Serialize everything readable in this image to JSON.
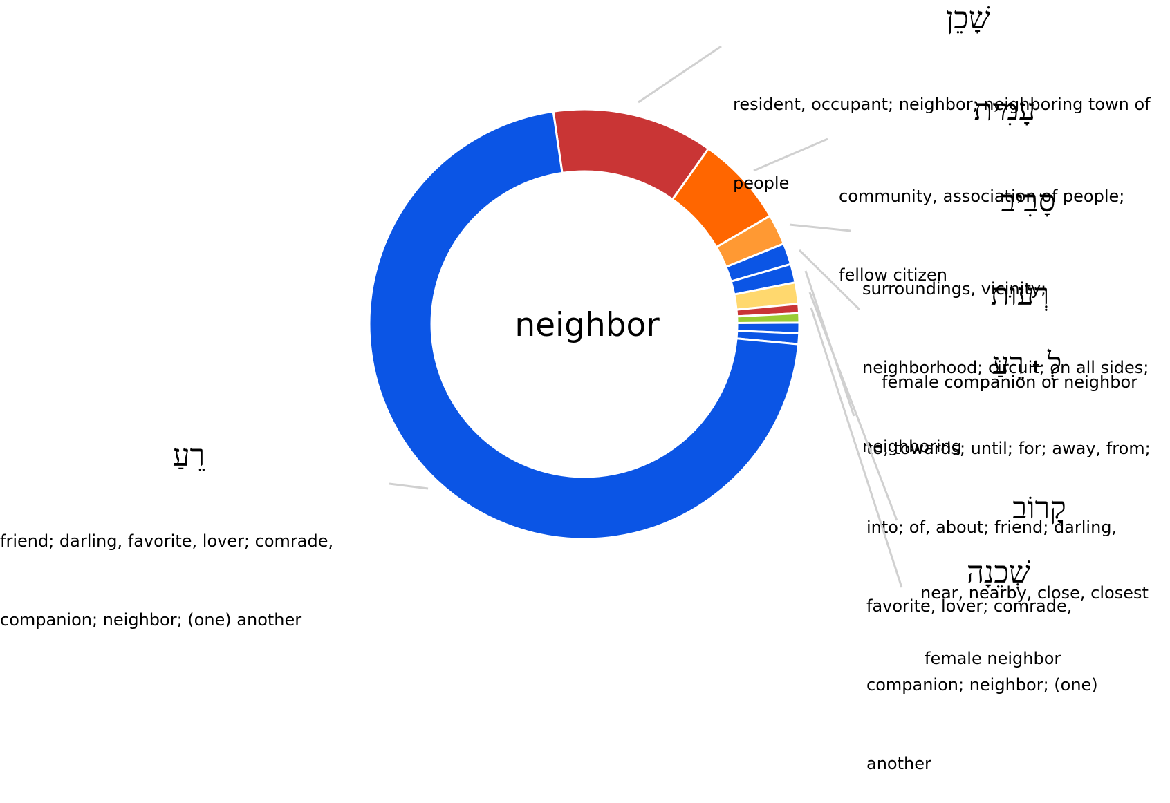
{
  "chart_data": {
    "type": "pie",
    "variant": "donut",
    "title": "neighbor",
    "start_angle_deg": -8.3,
    "direction": "clockwise",
    "slices": [
      {
        "id": "shakhen",
        "hebrew": "שָׁכֵן",
        "gloss": [
          "resident, occupant; neighbor; neighboring town of",
          "people"
        ],
        "value": 12.1,
        "color": "#c93535",
        "labeled": true
      },
      {
        "id": "amit",
        "hebrew": "עָמִית",
        "gloss": [
          "community, association of people;",
          "fellow citizen"
        ],
        "value": 6.8,
        "color": "#ff6600",
        "labeled": true
      },
      {
        "id": "saviv",
        "hebrew": "סָבִיב",
        "gloss": [
          "surroundings, vicinity;",
          "neighborhood; circuit; on all sides;",
          "neighboring"
        ],
        "value": 2.3,
        "color": "#ff9933",
        "labeled": true
      },
      {
        "id": "reut",
        "hebrew": "רְעוּת",
        "gloss": [
          "female companion or neighbor"
        ],
        "value": 1.6,
        "color": "#0b55e5",
        "labeled": true
      },
      {
        "id": "le-rea",
        "hebrew_parts": [
          "לְ",
          "+",
          "רֵעַ"
        ],
        "gloss": [
          "to, towards; until; for; away, from;",
          "into; of, about; friend; darling,",
          "favorite, lover; comrade,",
          "companion; neighbor; (one)",
          "another"
        ],
        "value": 1.4,
        "color": "#0b55e5",
        "labeled": true
      },
      {
        "id": "unlabeled-yellow",
        "value": 1.6,
        "color": "#ffd86e",
        "labeled": false
      },
      {
        "id": "karov",
        "hebrew": "קָרוֹב",
        "gloss": [
          "near, nearby, close, closest"
        ],
        "value": 0.7,
        "color": "#c93535",
        "labeled": true
      },
      {
        "id": "unlabeled-green",
        "value": 0.7,
        "color": "#99cc33",
        "labeled": false
      },
      {
        "id": "shkhenah",
        "hebrew": "שְׁכֵנָה",
        "gloss": [
          "female neighbor"
        ],
        "value": 0.8,
        "color": "#0b55e5",
        "labeled": true
      },
      {
        "id": "unlabeled-blue",
        "value": 0.8,
        "color": "#0b55e5",
        "labeled": false
      },
      {
        "id": "rea",
        "hebrew": "רֵעַ",
        "gloss": [
          "friend; darling, favorite, lover; comrade,",
          "companion; neighbor; (one) another"
        ],
        "value": 71.2,
        "color": "#0b55e5",
        "labeled": true
      }
    ],
    "separator_color": "#ffffff",
    "leader_color": "#d0d0d0",
    "legend": "none"
  }
}
